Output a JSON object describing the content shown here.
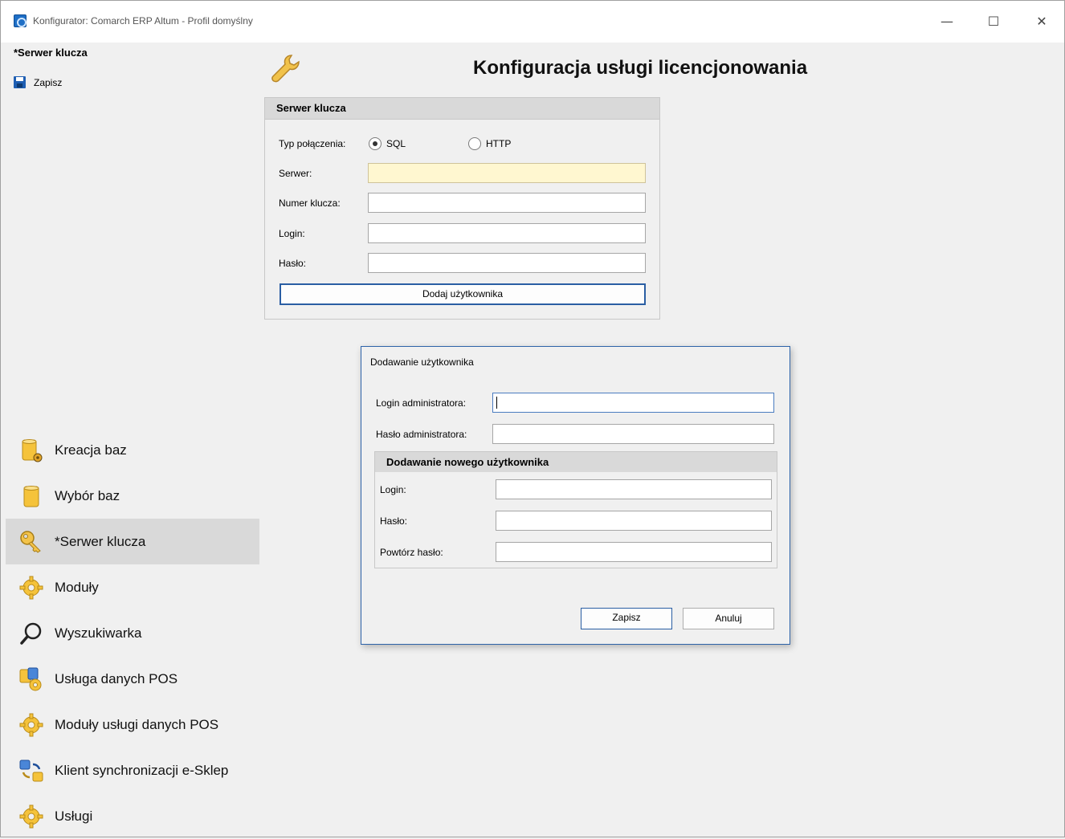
{
  "window": {
    "title": "Konfigurator: Comarch ERP Altum - Profil domyślny",
    "minimize": "—",
    "maximize": "☐",
    "close": "✕"
  },
  "toolbar": {
    "section_title": "*Serwer klucza",
    "save_label": "Zapisz"
  },
  "header": {
    "title": "Konfiguracja usługi licencjonowania"
  },
  "key_server": {
    "panel_title": "Serwer klucza",
    "connection_type_label": "Typ połączenia:",
    "options": [
      "SQL",
      "HTTP"
    ],
    "selected": "SQL",
    "server_label": "Serwer:",
    "server_value": "",
    "key_number_label": "Numer klucza:",
    "key_number_value": "",
    "login_label": "Login:",
    "login_value": "",
    "password_label": "Hasło:",
    "password_value": "",
    "add_user_button": "Dodaj użytkownika"
  },
  "dialog": {
    "title": "Dodawanie użytkownika",
    "admin_login_label": "Login administratora:",
    "admin_login_value": "",
    "admin_password_label": "Hasło administratora:",
    "admin_password_value": "",
    "group_title": "Dodawanie nowego użytkownika",
    "login_label": "Login:",
    "password_label": "Hasło:",
    "repeat_password_label": "Powtórz hasło:",
    "save_button": "Zapisz",
    "cancel_button": "Anuluj"
  },
  "navigation": {
    "items": [
      {
        "label": "Kreacja baz",
        "icon": "database-gear-icon"
      },
      {
        "label": "Wybór baz",
        "icon": "database-icon"
      },
      {
        "label": "*Serwer klucza",
        "icon": "key-icon",
        "active": true
      },
      {
        "label": "Moduły",
        "icon": "gear-icon"
      },
      {
        "label": "Wyszukiwarka",
        "icon": "magnifier-icon"
      },
      {
        "label": "Usługa danych POS",
        "icon": "pos-data-service-icon"
      },
      {
        "label": "Moduły usługi danych POS",
        "icon": "gear-icon"
      },
      {
        "label": "Klient synchronizacji e-Sklep",
        "icon": "sync-icon"
      },
      {
        "label": "Usługi",
        "icon": "gear-icon"
      }
    ]
  },
  "colors": {
    "accent": "#2a5ea3",
    "active_nav": "#d9d9d9",
    "highlight_field": "#fff7d0"
  }
}
